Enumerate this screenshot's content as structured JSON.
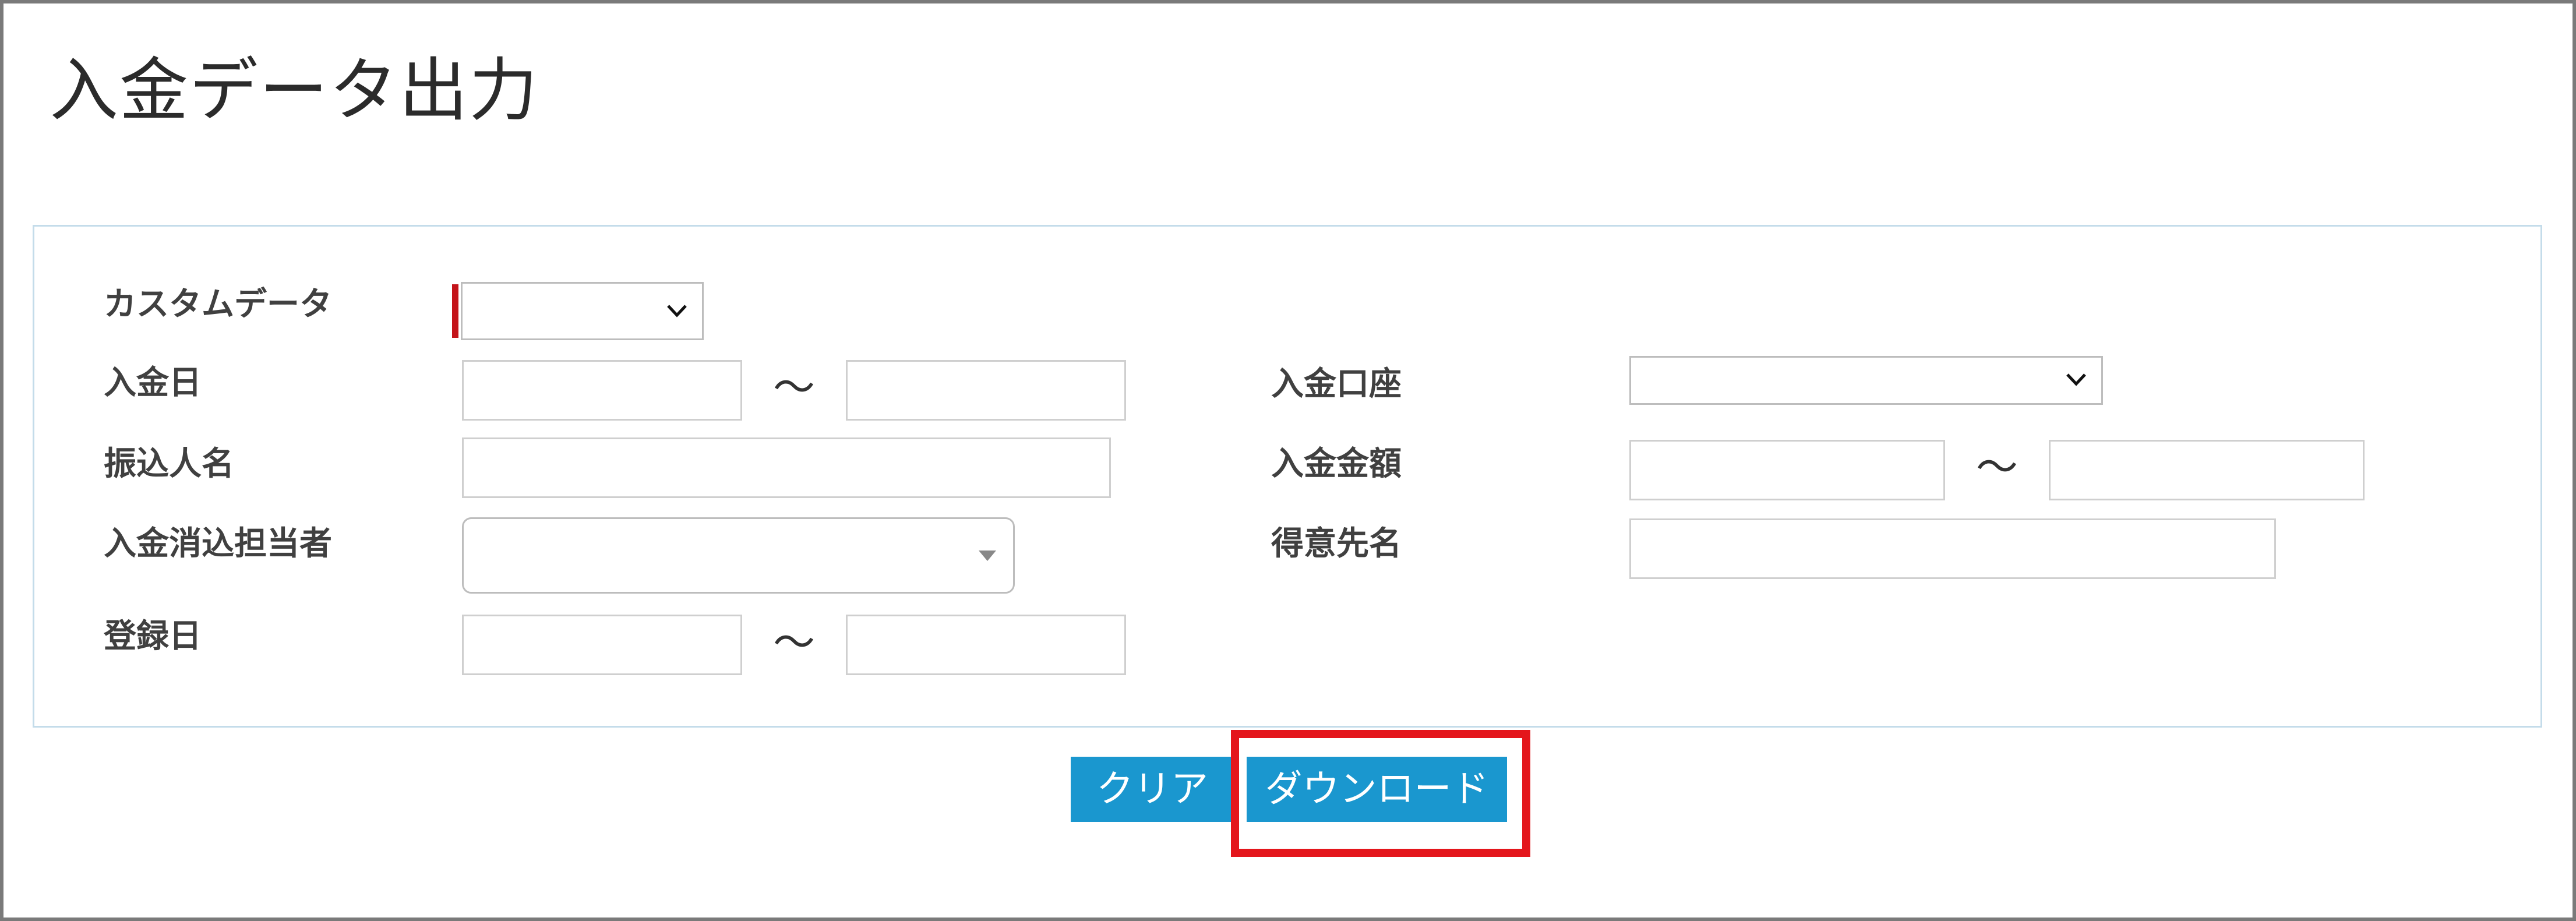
{
  "page": {
    "title": "入金データ出力"
  },
  "form": {
    "custom_data": {
      "label": "カスタムデータ",
      "value": ""
    },
    "deposit_date": {
      "label": "入金日",
      "from": "",
      "to": "",
      "separator": "～"
    },
    "transfer_name": {
      "label": "振込人名",
      "value": ""
    },
    "clearing_person": {
      "label": "入金消込担当者",
      "value": ""
    },
    "registration_date": {
      "label": "登録日",
      "from": "",
      "to": "",
      "separator": "～"
    },
    "deposit_account": {
      "label": "入金口座",
      "value": ""
    },
    "deposit_amount": {
      "label": "入金金額",
      "from": "",
      "to": "",
      "separator": "～"
    },
    "customer_name": {
      "label": "得意先名",
      "value": ""
    }
  },
  "actions": {
    "clear_label": "クリア",
    "download_label": "ダウンロード"
  },
  "icons": {
    "select_chevron": "chevron-down-icon",
    "combo_caret": "caret-down-icon"
  },
  "colors": {
    "button": "#1a97cf",
    "highlight": "#e4161c",
    "required_marker": "#c4141a",
    "panel_border": "#c4dcea"
  }
}
